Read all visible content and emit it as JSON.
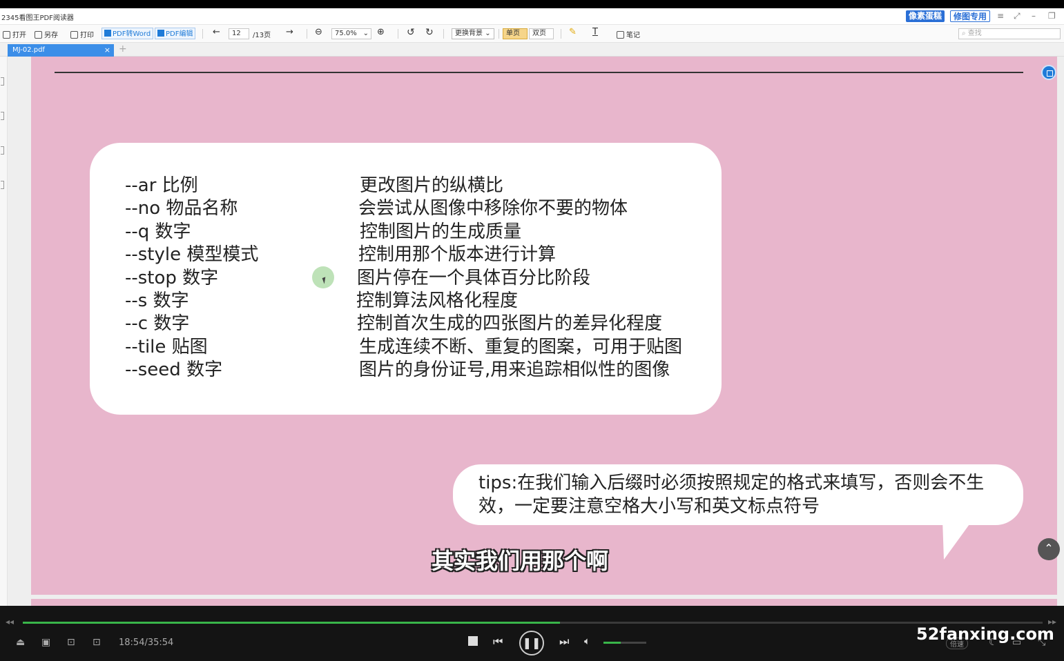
{
  "window": {
    "title": "2345看图王PDF阅读器",
    "badge_pixel": "像素蛋糕",
    "badge_retouch": "修图专用",
    "accent": "#3b8ee8"
  },
  "toolbar": {
    "open": "打开",
    "save_as": "另存",
    "print": "打印",
    "pdf_to_word": "PDF转Word",
    "pdf_edit": "PDF编辑",
    "page_current": "12",
    "page_total": "/13页",
    "zoom": "75.0%",
    "background": "更换背景",
    "single_page": "单页",
    "double_page": "双页",
    "notes": "笔记",
    "search_placeholder": "查找"
  },
  "tabs": [
    {
      "label": "MJ-02.pdf"
    }
  ],
  "document": {
    "params": [
      {
        "cmd": "--ar 比例",
        "desc": "更改图片的纵横比"
      },
      {
        "cmd": "--no 物品名称",
        "desc": "会尝试从图像中移除你不要的物体"
      },
      {
        "cmd": "--q 数字",
        "desc": "控制图片的生成质量"
      },
      {
        "cmd": "--style 模型模式",
        "desc": "控制用那个版本进行计算"
      },
      {
        "cmd": "--stop 数字",
        "desc": "图片停在一个具体百分比阶段"
      },
      {
        "cmd": "--s 数字",
        "desc": "控制算法风格化程度"
      },
      {
        "cmd": "--c 数字",
        "desc": "控制首次生成的四张图片的差异化程度"
      },
      {
        "cmd": "--tile 贴图",
        "desc": "生成连续不断、重复的图案，可用于贴图"
      },
      {
        "cmd": "--seed 数字",
        "desc": "图片的身份证号,用来追踪相似性的图像"
      }
    ],
    "tips": "tips:在我们输入后缀时必须按照规定的格式来填写，否则会不生效，一定要注意空格大小写和英文标点符号",
    "page_bg": "#e8b6cc"
  },
  "subtitle": "其实我们用那个啊",
  "player": {
    "time": "18:54/35:54",
    "progress": 0.527,
    "volume": 0.4,
    "speed_label": "倍速",
    "brand": "52fanxing.com",
    "progress_color": "#39b54a"
  }
}
